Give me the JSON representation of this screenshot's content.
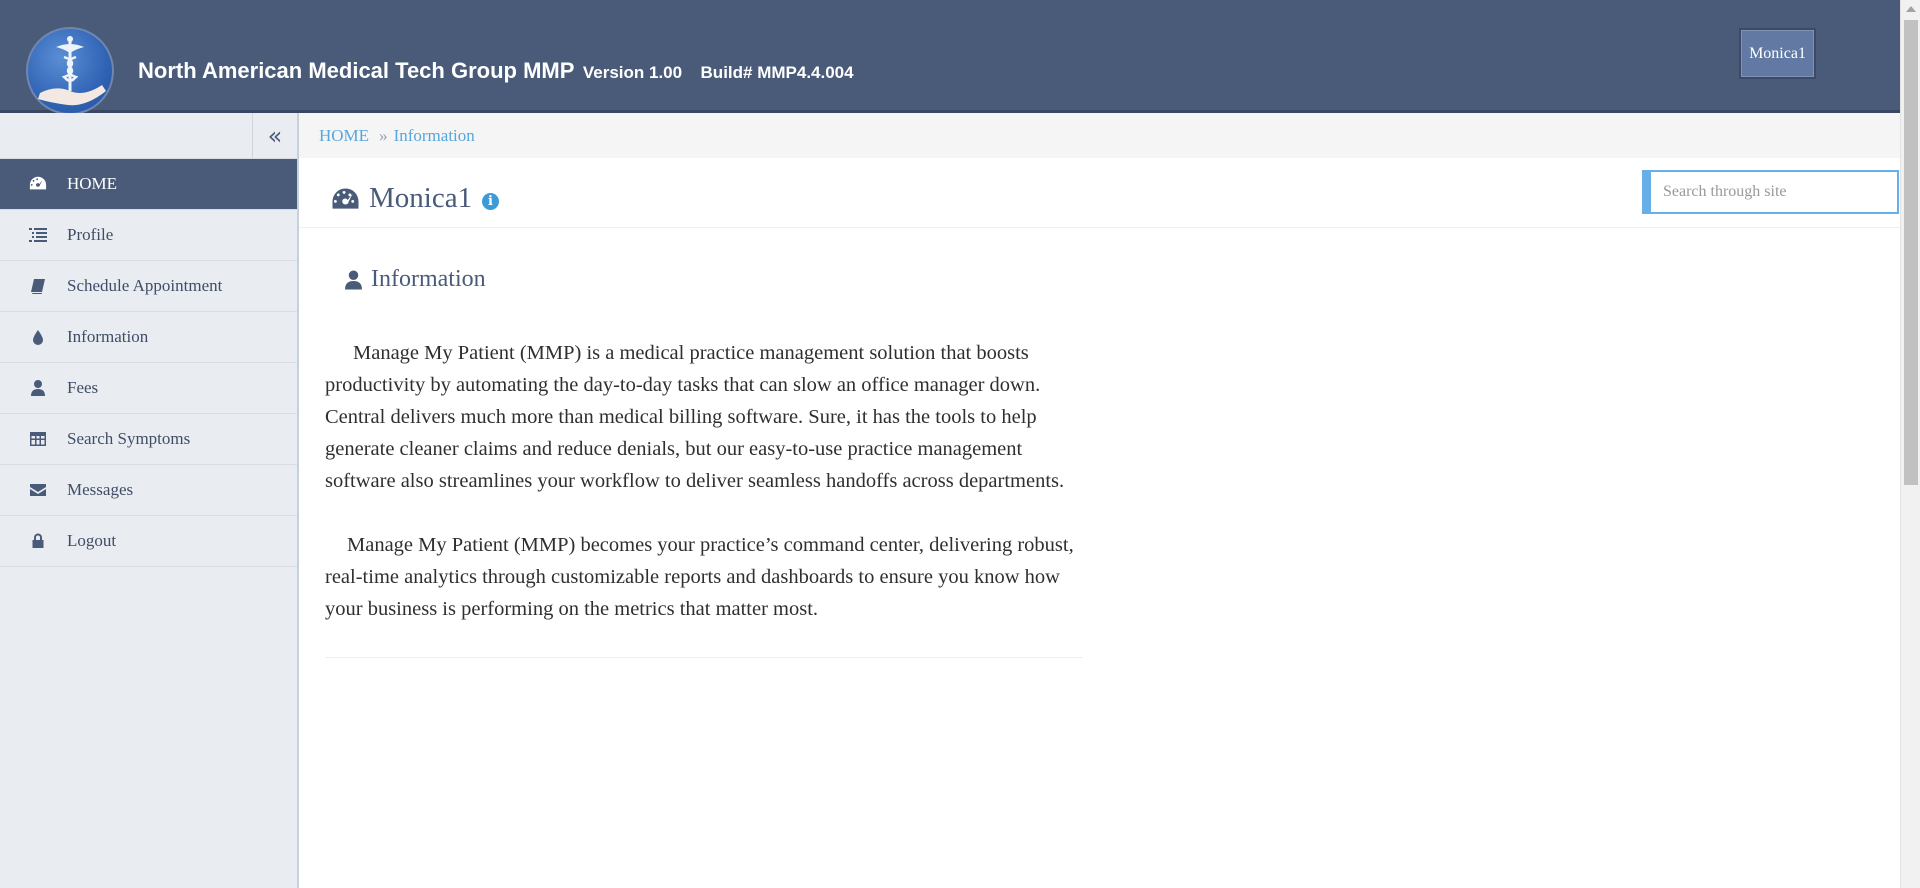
{
  "header": {
    "company_name": "North American Medical Tech Group MMP",
    "version": "Version 1.00",
    "build": "Build# MMP4.4.004",
    "user_button": "Monica1",
    "colors": {
      "header_bg": "#4a5b7a",
      "accent": "#57a6d9"
    }
  },
  "sidebar": {
    "collapse_icon": "double-chevron-left-icon",
    "items": [
      {
        "label": "HOME",
        "icon": "dashboard-icon",
        "active": true
      },
      {
        "label": "Profile",
        "icon": "list-icon",
        "active": false
      },
      {
        "label": "Schedule Appointment",
        "icon": "book-icon",
        "active": false
      },
      {
        "label": "Information",
        "icon": "drop-icon",
        "active": false
      },
      {
        "label": "Fees",
        "icon": "user-icon",
        "active": false
      },
      {
        "label": "Search Symptoms",
        "icon": "table-icon",
        "active": false
      },
      {
        "label": "Messages",
        "icon": "envelope-icon",
        "active": false
      },
      {
        "label": "Logout",
        "icon": "lock-icon",
        "active": false
      }
    ]
  },
  "breadcrumb": {
    "home": "HOME",
    "separator": "»",
    "current": "Information"
  },
  "page": {
    "title": "Monica1",
    "info_icon": "info-circle-icon",
    "search_placeholder": "Search through site"
  },
  "section": {
    "title": "Information",
    "paragraphs": [
      "Manage My Patient (MMP) is a medical practice management solution that boosts productivity by automating the day-to-day tasks that can slow an office manager down. Central delivers much more than medical billing software. Sure, it has the tools to help generate cleaner claims and reduce denials, but our easy-to-use practice management software also streamlines your workflow to deliver seamless handoffs across departments.",
      "Manage My Patient (MMP) becomes your practice’s command center, delivering robust, real-time analytics through customizable reports and dashboards to ensure you know how your business is performing on the metrics that matter most."
    ]
  }
}
